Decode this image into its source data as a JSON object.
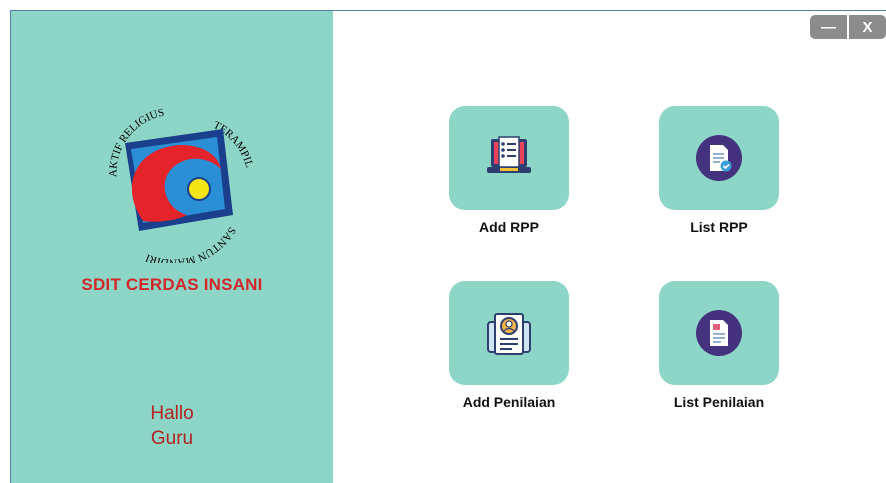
{
  "window_controls": {
    "minimize_label": "—",
    "close_label": "X"
  },
  "sidebar": {
    "logo_texts": [
      "AKTIF",
      "RELIGIUS",
      "TERAMPIL",
      "SANTUN",
      "MANDIRI"
    ],
    "school_name": "SDIT CERDAS INSANI",
    "greeting_line1": "Hallo",
    "greeting_line2": "Guru"
  },
  "menu": {
    "tiles": [
      {
        "label": "Add RPP",
        "icon": "laptop-checklist-icon"
      },
      {
        "label": "List RPP",
        "icon": "document-check-icon"
      },
      {
        "label": "Add Penilaian",
        "icon": "profile-card-icon"
      },
      {
        "label": "List Penilaian",
        "icon": "document-photo-icon"
      }
    ]
  },
  "colors": {
    "sidebar_bg": "#8dd5c7",
    "tile_bg": "#8dd5c7",
    "school_name": "#d0282b",
    "greeting": "#b22222",
    "window_button": "#8c8c8c",
    "icon_circle": "#45327e"
  }
}
